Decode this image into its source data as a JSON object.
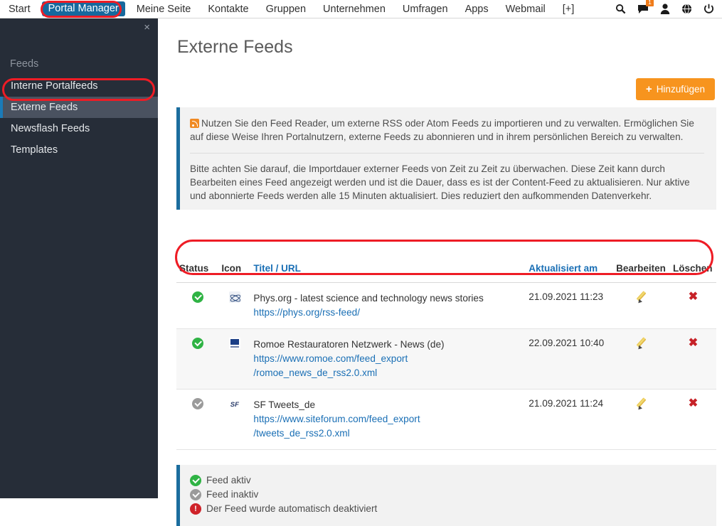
{
  "topnav": {
    "items": [
      {
        "label": "Start",
        "active": false
      },
      {
        "label": "Portal Manager",
        "active": true
      },
      {
        "label": "Meine Seite",
        "active": false
      },
      {
        "label": "Kontakte",
        "active": false
      },
      {
        "label": "Gruppen",
        "active": false
      },
      {
        "label": "Unternehmen",
        "active": false
      },
      {
        "label": "Umfragen",
        "active": false
      },
      {
        "label": "Apps",
        "active": false
      },
      {
        "label": "Webmail",
        "active": false
      },
      {
        "label": "[+]",
        "active": false
      }
    ],
    "icons": [
      {
        "name": "search-icon",
        "glyph": "⌕"
      },
      {
        "name": "messages-icon",
        "glyph": "⬛",
        "badge": "1"
      },
      {
        "name": "user-icon",
        "glyph": "♟"
      },
      {
        "name": "globe-icon",
        "glyph": "⊕"
      },
      {
        "name": "power-icon",
        "glyph": "⏻"
      }
    ],
    "badge_count": "1",
    "active_color": "#16699e",
    "badge_color": "#f07c1a"
  },
  "sidebar": {
    "close_label": "×",
    "heading": "Feeds",
    "items": [
      {
        "label": "Interne Portalfeeds",
        "selected": false
      },
      {
        "label": "Externe Feeds",
        "selected": true
      },
      {
        "label": "Newsflash Feeds",
        "selected": false
      },
      {
        "label": "Templates",
        "selected": false
      }
    ],
    "background_color": "#262d38",
    "accent_color": "#1a7bb9"
  },
  "main": {
    "page_title": "Externe Feeds",
    "add_button": {
      "label": "Hinzufügen",
      "plus": "+",
      "color": "#f7941e"
    },
    "info": {
      "paragraph1": "Nutzen Sie den Feed Reader, um externe RSS oder Atom Feeds zu importieren und zu verwalten. Ermöglichen Sie auf diese Weise Ihren Portalnutzern, externe Feeds zu abonnieren und in ihrem persönlichen Bereich zu verwalten.",
      "paragraph2": "Bitte achten Sie darauf, die Importdauer externer Feeds von Zeit zu Zeit zu überwachen. Diese Zeit kann durch Bearbeiten eines Feed angezeigt werden und ist die Dauer, dass es ist der Content-Feed zu aktualisieren. Nur aktive und abonnierte Feeds werden alle 15 Minuten aktualisiert. Dies reduziert den aufkommenden Datenverkehr.",
      "accent_color": "#1b6d9e",
      "background_color": "#f2f2f2"
    },
    "table": {
      "headers": {
        "status": "Status",
        "icon": "Icon",
        "title_url": "Titel / URL",
        "updated": "Aktualisiert am",
        "edit": "Bearbeiten",
        "delete": "Löschen"
      },
      "link_color": "#1a6fb5",
      "rows": [
        {
          "status": "active",
          "icon": "phys-favicon",
          "title": "Phys.org - latest science and technology news stories",
          "url": "https://phys.org/rss-feed/",
          "updated": "21.09.2021 11:23",
          "edit": "edit-icon",
          "delete": "delete-icon"
        },
        {
          "status": "active",
          "icon": "romoe-favicon",
          "title": "Romoe Restauratoren Netzwerk - News (de)",
          "url": "https://www.romoe.com/feed_export/romoe_news_de_rss2.0.xml",
          "url_line1": "https://www.romoe.com/feed_export",
          "url_line2": "/romoe_news_de_rss2.0.xml",
          "updated": "22.09.2021 10:40",
          "edit": "edit-icon",
          "delete": "delete-icon"
        },
        {
          "status": "inactive",
          "icon": "sf-favicon",
          "icon_text": "SF",
          "title": "SF Tweets_de",
          "url": "https://www.siteforum.com/feed_export/tweets_de_rss2.0.xml",
          "url_line1": "https://www.siteforum.com/feed_export",
          "url_line2": "/tweets_de_rss2.0.xml",
          "updated": "21.09.2021 11:24",
          "edit": "edit-icon",
          "delete": "delete-icon"
        }
      ]
    },
    "legend": {
      "active": "Feed aktiv",
      "inactive": "Feed inaktiv",
      "auto_disabled": "Der Feed wurde automatisch deaktiviert",
      "active_color": "#2fb344",
      "inactive_color": "#9b9b9b",
      "error_color": "#cf2229"
    }
  },
  "annotations": {
    "color": "#ee1c25",
    "targets": [
      "portal-manager-nav-item",
      "externe-feeds-sidebar-item",
      "table-header-row"
    ]
  }
}
